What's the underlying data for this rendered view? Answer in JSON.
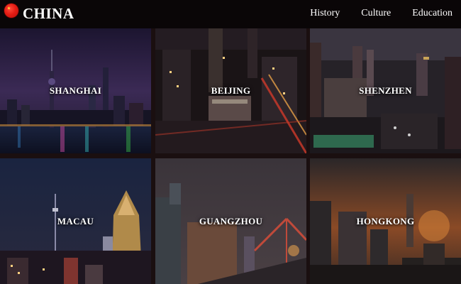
{
  "header": {
    "brand": "CHINA",
    "nav": [
      "History",
      "Culture",
      "Education"
    ]
  },
  "cities": [
    {
      "name": "SHANGHAI"
    },
    {
      "name": "BEIJING"
    },
    {
      "name": "SHENZHEN"
    },
    {
      "name": "MACAU"
    },
    {
      "name": "GUANGZHOU"
    },
    {
      "name": "HONGKONG"
    }
  ],
  "colors": {
    "background": "#0d0809",
    "header": "#0a0607",
    "text": "#ffffff",
    "flag_red": "#e51d14",
    "flag_star": "#ffde3a"
  }
}
